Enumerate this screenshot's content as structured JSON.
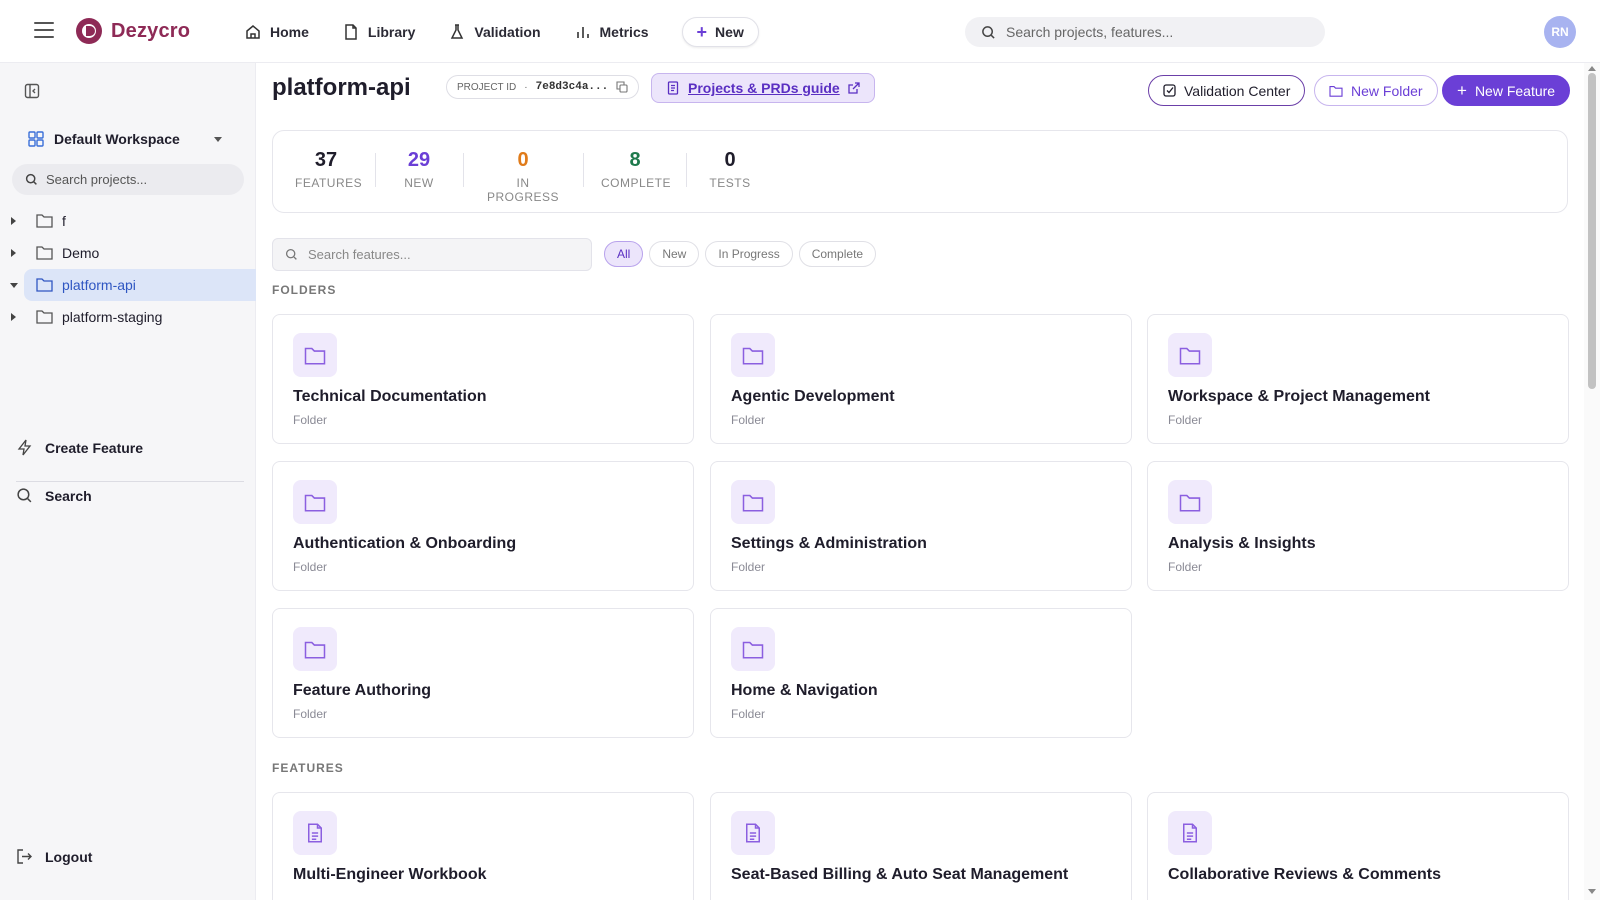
{
  "brand": {
    "name": "Dezycro"
  },
  "nav": {
    "items": [
      {
        "label": "Home",
        "icon": "home-icon"
      },
      {
        "label": "Library",
        "icon": "file-icon"
      },
      {
        "label": "Validation",
        "icon": "flask-icon"
      },
      {
        "label": "Metrics",
        "icon": "bar-chart-icon"
      }
    ],
    "new_label": "New"
  },
  "search": {
    "placeholder": "Search projects, features..."
  },
  "user": {
    "initials": "RN"
  },
  "sidebar": {
    "workspace": "Default Workspace",
    "search_placeholder": "Search projects...",
    "tree": [
      {
        "label": "f",
        "active": false
      },
      {
        "label": "Demo",
        "active": false
      },
      {
        "label": "platform-api",
        "active": true
      },
      {
        "label": "platform-staging",
        "active": false
      }
    ],
    "create_feature": "Create Feature",
    "search": "Search",
    "logout": "Logout"
  },
  "header": {
    "title": "platform-api",
    "project_id_label": "PROJECT ID",
    "project_id_value": "7e8d3c4a...",
    "guide_label": "Projects & PRDs guide",
    "validation_center": "Validation Center",
    "new_folder": "New Folder",
    "new_feature": "New Feature"
  },
  "stats": [
    {
      "value": "37",
      "label": "FEATURES",
      "color": "#1f1d2b"
    },
    {
      "value": "29",
      "label": "NEW",
      "color": "#6b3fd6"
    },
    {
      "value": "0",
      "label": "IN PROGRESS",
      "color": "#e07b1a"
    },
    {
      "value": "8",
      "label": "COMPLETE",
      "color": "#1e7a4c"
    },
    {
      "value": "0",
      "label": "TESTS",
      "color": "#1f1d2b"
    }
  ],
  "filters": {
    "search_placeholder": "Search features...",
    "chips": [
      "All",
      "New",
      "In Progress",
      "Complete"
    ],
    "active": "All"
  },
  "folders_label": "FOLDERS",
  "folders": [
    {
      "title": "Technical Documentation",
      "sub": "Folder"
    },
    {
      "title": "Agentic Development",
      "sub": "Folder"
    },
    {
      "title": "Workspace & Project Management",
      "sub": "Folder"
    },
    {
      "title": "Authentication & Onboarding",
      "sub": "Folder"
    },
    {
      "title": "Settings & Administration",
      "sub": "Folder"
    },
    {
      "title": "Analysis & Insights",
      "sub": "Folder"
    },
    {
      "title": "Feature Authoring",
      "sub": "Folder"
    },
    {
      "title": "Home & Navigation",
      "sub": "Folder"
    }
  ],
  "features_label": "FEATURES",
  "features": [
    {
      "title": "Multi-Engineer Workbook"
    },
    {
      "title": "Seat-Based Billing & Auto Seat Management"
    },
    {
      "title": "Collaborative Reviews & Comments"
    }
  ],
  "colors": {
    "accent": "#6b3fd6",
    "brand": "#8e2a56"
  }
}
